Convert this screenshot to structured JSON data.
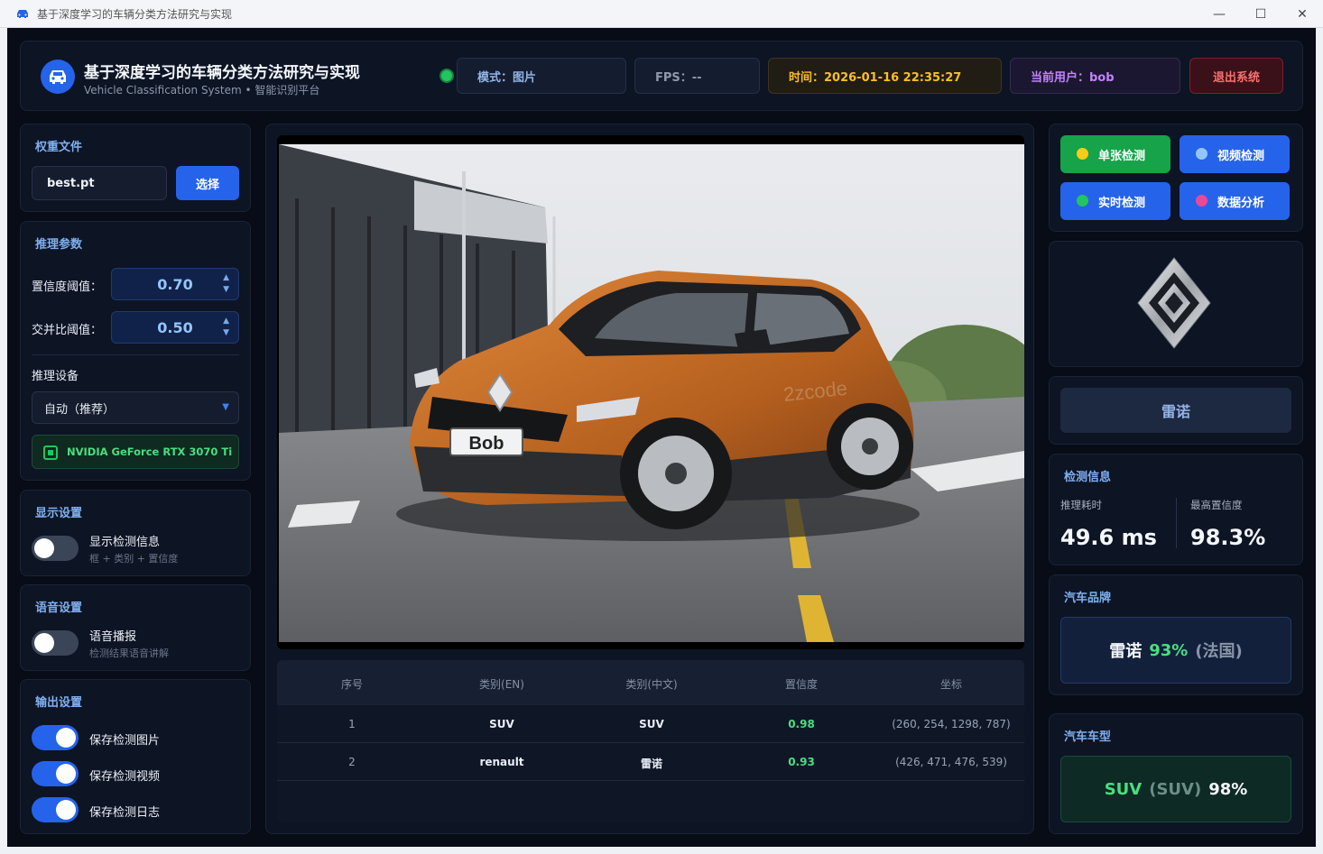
{
  "window": {
    "title": "基于深度学习的车辆分类方法研究与实现",
    "minimize": "—",
    "maximize": "☐",
    "close": "✕"
  },
  "header": {
    "title": "基于深度学习的车辆分类方法研究与实现",
    "subtitle": "Vehicle Classification System • 智能识别平台",
    "mode": "模式：图片",
    "fps": "FPS：--",
    "time": "时间：2026-01-16 22:35:27",
    "user": "当前用户：bob",
    "logout": "退出系统"
  },
  "weights": {
    "title": "权重文件",
    "file": "best.pt",
    "choose": "选择"
  },
  "inference": {
    "title": "推理参数",
    "conf_label": "置信度阈值：",
    "conf_value": "0.70",
    "iou_label": "交并比阈值：",
    "iou_value": "0.50",
    "device_label": "推理设备",
    "device_value": "自动（推荐）",
    "gpu": "NVIDIA GeForce RTX 3070 Ti"
  },
  "display": {
    "title": "显示设置",
    "toggle_label": "显示检测信息",
    "toggle_sub": "框 + 类别 + 置信度",
    "on": false
  },
  "voice": {
    "title": "语音设置",
    "toggle_label": "语音播报",
    "toggle_sub": "检测结果语音讲解",
    "on": false
  },
  "output": {
    "title": "输出设置",
    "items": [
      {
        "label": "保存检测图片",
        "on": true
      },
      {
        "label": "保存检测视频",
        "on": true
      },
      {
        "label": "保存检测日志",
        "on": true
      }
    ]
  },
  "image": {
    "plate": "Bob",
    "watermark": "2zcode"
  },
  "table": {
    "headers": [
      "序号",
      "类别(EN)",
      "类别(中文)",
      "置信度",
      "坐标"
    ],
    "rows": [
      [
        "1",
        "SUV",
        "SUV",
        "0.98",
        "(260, 254, 1298, 787)"
      ],
      [
        "2",
        "renault",
        "雷诺",
        "0.93",
        "(426, 471, 476, 539)"
      ]
    ]
  },
  "modes": {
    "single": "单张检测",
    "video": "视频检测",
    "realtime": "实时检测",
    "analysis": "数据分析"
  },
  "brand_name": "雷诺",
  "detect_info": {
    "title": "检测信息",
    "time_label": "推理耗时",
    "time_value": "49.6 ms",
    "conf_label": "最高置信度",
    "conf_value": "98.3%"
  },
  "brand": {
    "title": "汽车品牌",
    "name": "雷诺",
    "pct": "93%",
    "country": "(法国)"
  },
  "model": {
    "title": "汽车车型",
    "name": "SUV",
    "alt": "(SUV)",
    "pct": "98%"
  },
  "colors": {
    "accent": "#2563eb",
    "success": "#22c55e",
    "warning": "#fbbf24",
    "danger": "#f87171",
    "user": "#c084fc",
    "single_btn": "#16a34a",
    "single_dot": "#facc15",
    "video_dot": "#93c5fd",
    "realtime_dot": "#22c55e",
    "analysis_dot": "#ec4899"
  }
}
